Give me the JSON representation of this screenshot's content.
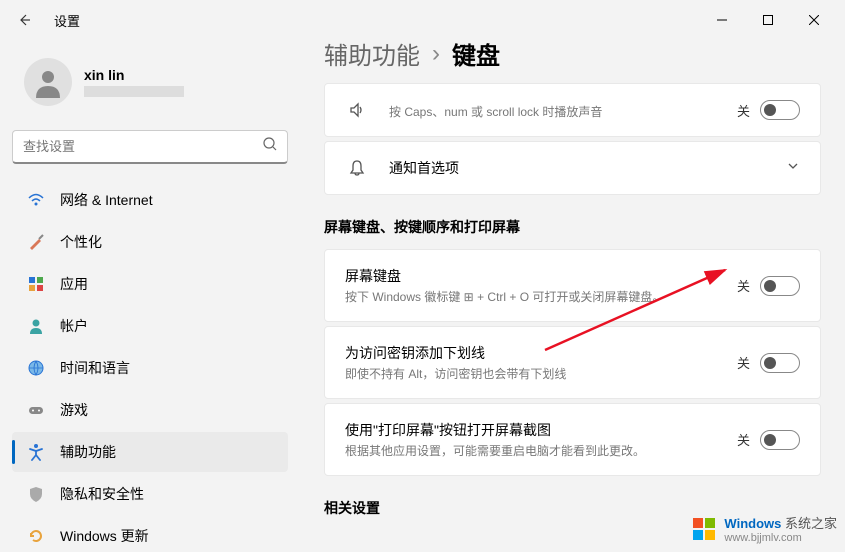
{
  "window": {
    "title": "设置"
  },
  "user": {
    "name": "xin lin"
  },
  "search": {
    "placeholder": "查找设置"
  },
  "nav": {
    "items": [
      {
        "label": "网络 & Internet"
      },
      {
        "label": "个性化"
      },
      {
        "label": "应用"
      },
      {
        "label": "帐户"
      },
      {
        "label": "时间和语言"
      },
      {
        "label": "游戏"
      },
      {
        "label": "辅助功能"
      },
      {
        "label": "隐私和安全性"
      },
      {
        "label": "Windows 更新"
      }
    ]
  },
  "breadcrumb": {
    "parent": "辅助功能",
    "current": "键盘"
  },
  "cards": {
    "partial": {
      "desc": "按 Caps、num 或 scroll lock 时播放声音"
    },
    "notification": {
      "title": "通知首选项"
    }
  },
  "section1": {
    "header": "屏幕键盘、按键顺序和打印屏幕",
    "items": [
      {
        "title": "屏幕键盘",
        "desc": "按下 Windows 徽标键 ⊞ + Ctrl + O 可打开或关闭屏幕键盘。",
        "state": "关"
      },
      {
        "title": "为访问密钥添加下划线",
        "desc": "即使不持有 Alt，访问密钥也会带有下划线",
        "state": "关"
      },
      {
        "title": "使用\"打印屏幕\"按钮打开屏幕截图",
        "desc": "根据其他应用设置，可能需要重启电脑才能看到此更改。",
        "state": "关"
      }
    ]
  },
  "section2": {
    "header": "相关设置"
  },
  "watermark": {
    "brand": "Windows",
    "text": "系统之家",
    "url": "www.bjjmlv.com"
  }
}
